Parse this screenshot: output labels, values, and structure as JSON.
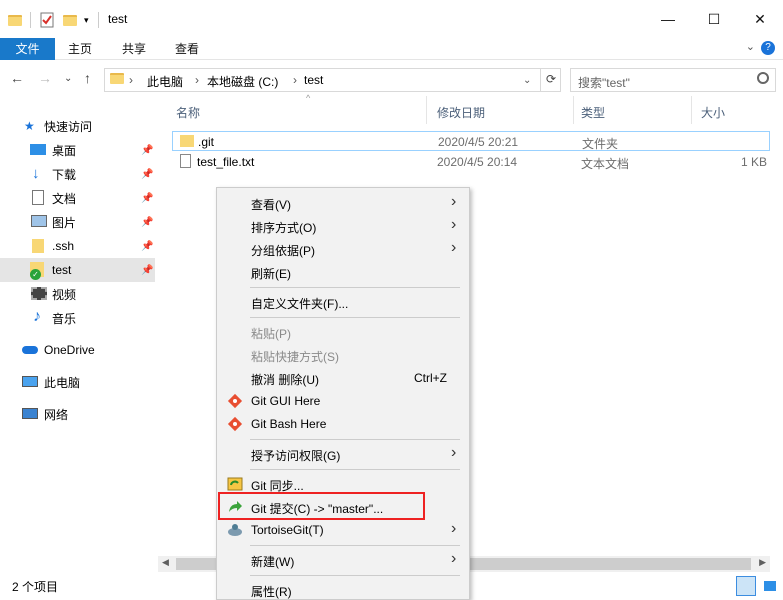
{
  "window": {
    "title": "test",
    "minimize_glyph": "—",
    "maximize_glyph": "☐",
    "close_glyph": "✕"
  },
  "ribbon": {
    "file_tab": "文件",
    "tabs": [
      "主页",
      "共享",
      "查看"
    ],
    "help_glyph": "?"
  },
  "address": {
    "crumbs": [
      "此电脑",
      "本地磁盘 (C:)",
      "test"
    ],
    "separator": "›",
    "search_placeholder": "搜索\"test\""
  },
  "nav": {
    "quick_access": "快速访问",
    "items": [
      {
        "label": "桌面",
        "icon": "desktop-icon",
        "pinned": true
      },
      {
        "label": "下载",
        "icon": "download-icon",
        "pinned": true
      },
      {
        "label": "文档",
        "icon": "document-icon",
        "pinned": true
      },
      {
        "label": "图片",
        "icon": "picture-icon",
        "pinned": true
      },
      {
        "label": ".ssh",
        "icon": "folder-icon",
        "pinned": true
      },
      {
        "label": "test",
        "icon": "git-folder-icon",
        "pinned": true,
        "selected": true
      },
      {
        "label": "视频",
        "icon": "video-icon",
        "pinned": false
      },
      {
        "label": "音乐",
        "icon": "music-icon",
        "pinned": false
      }
    ],
    "onedrive": "OneDrive",
    "this_pc": "此电脑",
    "network": "网络"
  },
  "columns": {
    "name": "名称",
    "modified": "修改日期",
    "type": "类型",
    "size": "大小"
  },
  "files": [
    {
      "name": ".git",
      "modified": "2020/4/5 20:21",
      "type": "文件夹",
      "size": "",
      "icon": "folder-icon"
    },
    {
      "name": "test_file.txt",
      "modified": "2020/4/5 20:14",
      "type": "文本文档",
      "size": "1 KB",
      "icon": "text-file-icon"
    }
  ],
  "status": {
    "count": "2 个项目"
  },
  "context_menu": {
    "items": [
      {
        "label": "查看(V)",
        "submenu": true
      },
      {
        "label": "排序方式(O)",
        "submenu": true
      },
      {
        "label": "分组依据(P)",
        "submenu": true
      },
      {
        "label": "刷新(E)"
      },
      {
        "label": "自定义文件夹(F)..."
      },
      {
        "label": "粘贴(P)",
        "disabled": true
      },
      {
        "label": "粘贴快捷方式(S)",
        "disabled": true
      },
      {
        "label": "撤消 删除(U)",
        "shortcut": "Ctrl+Z"
      },
      {
        "label": "Git GUI Here",
        "icon": "git-icon"
      },
      {
        "label": "Git Bash Here",
        "icon": "git-icon"
      },
      {
        "label": "授予访问权限(G)",
        "submenu": true
      },
      {
        "label": "Git 同步...",
        "icon": "git-sync-icon"
      },
      {
        "label": "Git 提交(C) -> \"master\"...",
        "icon": "git-commit-icon"
      },
      {
        "label": "TortoiseGit(T)",
        "icon": "tortoisegit-icon",
        "submenu": true
      },
      {
        "label": "新建(W)",
        "submenu": true
      },
      {
        "label": "属性(R)"
      }
    ]
  },
  "colors": {
    "accent": "#1979ca",
    "highlight_box": "#e22222",
    "selection": "#99d1ff"
  }
}
